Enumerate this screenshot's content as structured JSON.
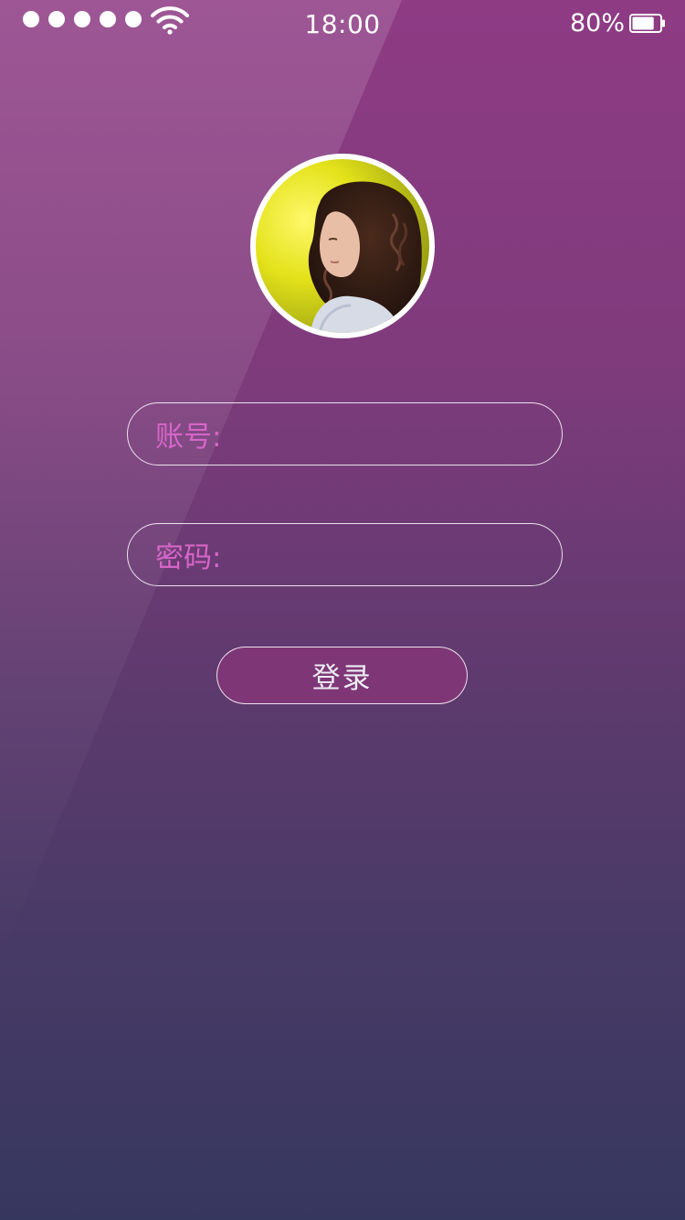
{
  "status_bar": {
    "signal_dots": 5,
    "wifi_icon": "wifi-icon",
    "time": "18:00",
    "battery_percent": "80%",
    "battery_level": 0.8,
    "battery_icon": "battery-icon"
  },
  "avatar": {
    "icon": "user-avatar-photo"
  },
  "form": {
    "account_label": "账号:",
    "account_value": "",
    "password_label": "密码:",
    "password_value": "",
    "login_label": "登录"
  },
  "colors": {
    "background_top": "#8e3b84",
    "background_bottom": "#36375f",
    "label_color": "#d765c8",
    "button_fill": "#7e3677",
    "border": "#ffffff"
  }
}
